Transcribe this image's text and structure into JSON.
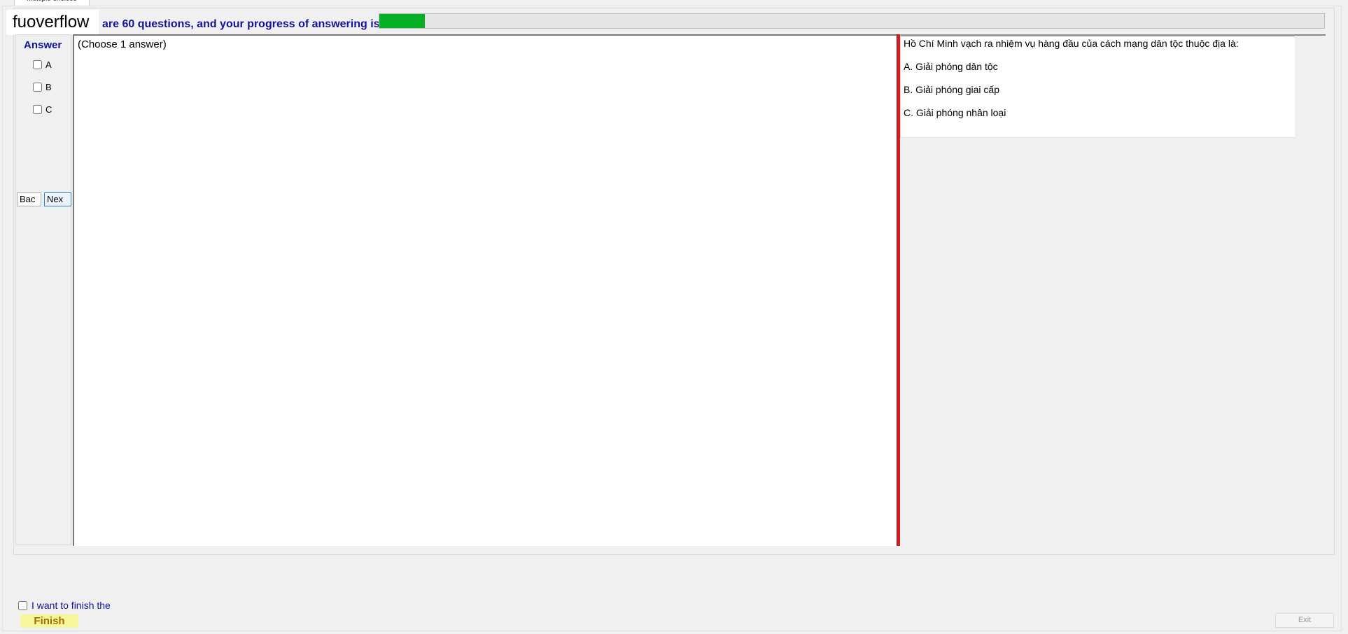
{
  "tab": {
    "label": "Multiple choices"
  },
  "header": {
    "logo_text": "fuoverflow",
    "progress_text": "are 60 questions, and your progress of answering is",
    "progress_fraction": 0.048,
    "progress_color": "#06b025"
  },
  "answer_panel": {
    "title": "Answer",
    "options": [
      {
        "label": "A",
        "checked": false
      },
      {
        "label": "B",
        "checked": false
      },
      {
        "label": "C",
        "checked": false
      }
    ],
    "back_label": "Bac",
    "next_label": "Nex"
  },
  "answer_area": {
    "hint": "(Choose 1 answer)"
  },
  "question": {
    "text": "Hồ Chí Minh vạch ra nhiệm vụ hàng đầu của cách mạng dân tộc thuộc địa là:",
    "choices": [
      "A.  Giải phóng dân tộc",
      "B.  Giải phóng giai cấp",
      "C.  Giải phóng nhân loại"
    ]
  },
  "footer": {
    "finish_checkbox_label": "I want to finish the",
    "finish_label": "Finish",
    "exit_label": "Exit"
  }
}
